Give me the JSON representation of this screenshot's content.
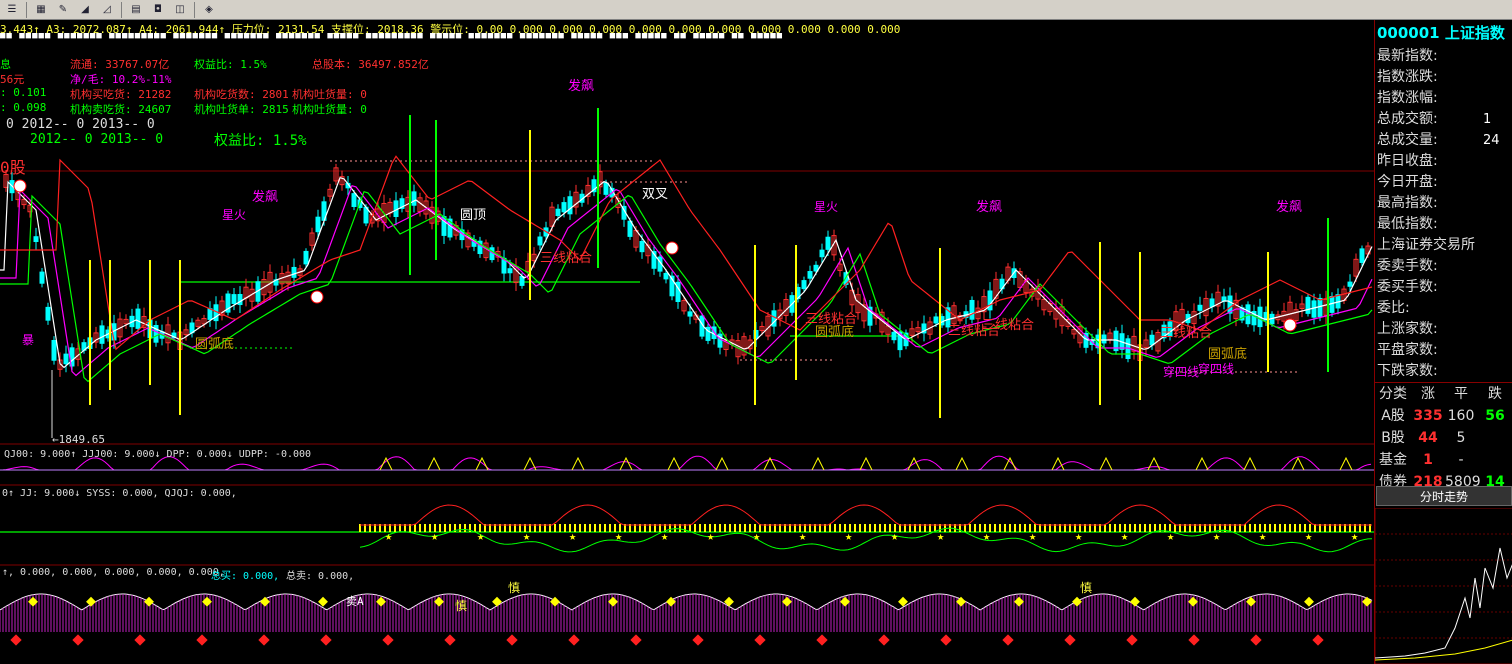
{
  "toolbar": {
    "icons": [
      "menu-icon",
      "chart-icon",
      "draw-icon",
      "measure-icon",
      "ruler-icon",
      "info-icon",
      "news-icon",
      "stock-icon",
      "hint-icon"
    ]
  },
  "header": {
    "ticker_line": "3.443↑  A3: 2072.087↑  A4: 2061.944↑  压力位: 2131.54  支撑位: 2018.36  警示位: 0.00  0.000  0.000  0.000  0.000  0.000  0.000  0.000  0.000  0.000  0.000"
  },
  "info": {
    "line1_a": "息",
    "line1_b": "流通: 33767.07亿",
    "line1_c": "权益比: 1.5%",
    "line1_d": "总股本: 36497.852亿",
    "line2_a": "56元",
    "line2_b": "净/毛: 10.2%-11%",
    "line3_a": ": 0.101",
    "line3_b": "机构买吃货: 21282",
    "line3_c": "机构吃货数: 2801",
    "line3_d": "机构吐货量: 0",
    "line4_a": ": 0.098",
    "line4_b": "机构卖吃货: 24607",
    "line4_c": "机构吐货单: 2815",
    "line4_d": "机构吐货量: 0",
    "line5_a": "0    2012-- 0    2013-- 0",
    "line6_a": "2012-- 0    2013-- 0",
    "line6_b": "权益比: 1.5%",
    "corner": "0股"
  },
  "annotations": {
    "yuanding": "圆顶",
    "shuangcha": "双叉",
    "sanxian1": "三线粘合",
    "sanxian2": "三线粘合",
    "sanxian3": "三线粘合",
    "sanxian4": "三线粘合",
    "sanxian5": "三线粘合",
    "yuanhu1": "圆弧底",
    "yuanhu2": "圆弧底",
    "yuanhu3": "圆弧底",
    "fapiao1": "发飙",
    "fapiao2": "发飙",
    "fapiao3": "发飙",
    "fapiao4": "发飙",
    "xinghuo1": "星火",
    "xinghuo2": "星火",
    "chuanxian1": "穿四线",
    "chuanxian2": "穿四线",
    "bao": "暴",
    "low_price": "←1849.65"
  },
  "indicators": {
    "p1": "QJ00: 9.000↑  JJJ00: 9.000↓  DPP: 0.000↓  UDPP: -0.000",
    "p2": "0↑  JJ: 9.000↓  SYSS: 0.000,  QJQJ: 0.000,",
    "p3_a": "↑, 0.000, 0.000, 0.000, 0.000, 0.000,",
    "p3_b": "总买: 0.000,",
    "p3_c": "总卖: 0.000,",
    "p4_shen": "慎",
    "p4_mai": "卖A"
  },
  "quote": {
    "code": "000001",
    "name": "上证指数",
    "rows": [
      {
        "label": "最新指数:"
      },
      {
        "label": "指数涨跌:"
      },
      {
        "label": "指数涨幅:"
      },
      {
        "label": "总成交额:",
        "value": "1"
      },
      {
        "label": "总成交量:",
        "value": "24"
      },
      {
        "label": "昨日收盘:"
      },
      {
        "label": "今日开盘:"
      },
      {
        "label": "最高指数:"
      },
      {
        "label": "最低指数:"
      },
      {
        "label": "上海证券交易所"
      },
      {
        "label": "委卖手数:"
      },
      {
        "label": "委买手数:"
      },
      {
        "label": "委比:"
      },
      {
        "label": "上涨家数:"
      },
      {
        "label": "平盘家数:"
      },
      {
        "label": "下跌家数:"
      }
    ]
  },
  "stats": {
    "header": [
      "分类",
      "涨",
      "平",
      "跌"
    ],
    "rows": [
      {
        "cat": "A股",
        "up": "335",
        "flat": "160",
        "down": "56"
      },
      {
        "cat": "B股",
        "up": "44",
        "flat": "5",
        "down": ""
      },
      {
        "cat": "基金",
        "up": "1",
        "flat": "-",
        "down": ""
      },
      {
        "cat": "债券",
        "up": "218",
        "flat": "5809",
        "down": "14"
      }
    ]
  },
  "tabs": {
    "intraday": "分时走势"
  },
  "colors": {
    "up": "#ff3030",
    "down": "#00ffff",
    "ma_white": "#ffffff",
    "ma_magenta": "#ff00ff",
    "ma_green": "#00ff00",
    "ma_red": "#ff2020",
    "yellow": "#ffff00"
  }
}
